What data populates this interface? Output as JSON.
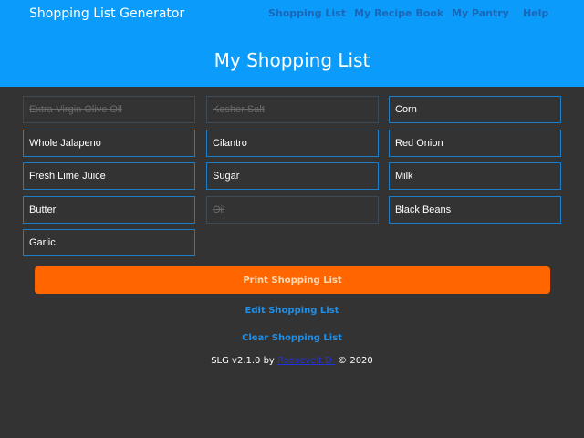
{
  "header": {
    "brand": "Shopping List Generator",
    "nav": [
      "Shopping List",
      "My Recipe Book",
      "My Pantry",
      "Help"
    ],
    "title": "My Shopping List"
  },
  "items": [
    {
      "label": "Extra-Virgin Olive Oil",
      "checked": true
    },
    {
      "label": "Kosher Salt",
      "checked": true
    },
    {
      "label": "Corn",
      "checked": false
    },
    {
      "label": "Whole Jalapeno",
      "checked": false
    },
    {
      "label": "Cilantro",
      "checked": false
    },
    {
      "label": "Red Onion",
      "checked": false
    },
    {
      "label": "Fresh Lime Juice",
      "checked": false
    },
    {
      "label": "Sugar",
      "checked": false
    },
    {
      "label": "Milk",
      "checked": false
    },
    {
      "label": "Butter",
      "checked": false
    },
    {
      "label": "Oil",
      "checked": true
    },
    {
      "label": "Black Beans",
      "checked": false
    },
    {
      "label": "Garlic",
      "checked": false
    }
  ],
  "actions": {
    "print": "Print Shopping List",
    "edit": "Edit Shopping List",
    "clear": "Clear Shopping List"
  },
  "footer": {
    "prefix": "SLG v2.1.0 by",
    "author": "Roosevelt D.",
    "suffix": "© 2020"
  },
  "colors": {
    "header_bg": "#0b9cfb",
    "page_bg": "#333333",
    "accent_orange": "#ff6600",
    "border_blue": "#1b7ec6"
  }
}
